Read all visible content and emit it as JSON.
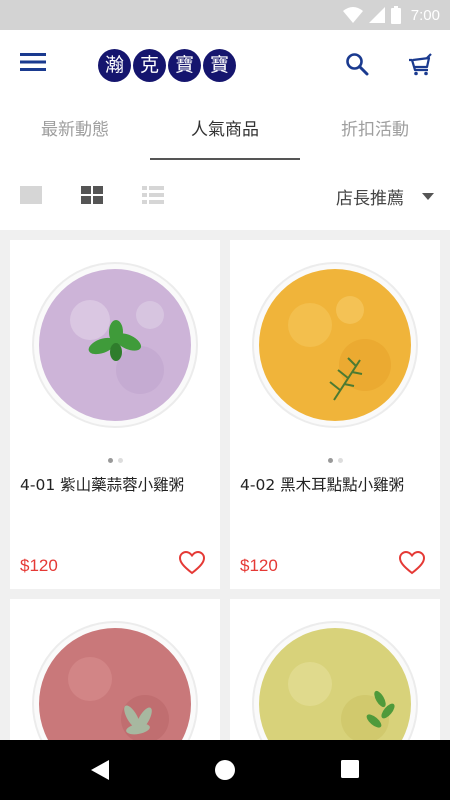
{
  "status_bar": {
    "time": "7:00"
  },
  "app": {
    "logo_chars": [
      "瀚",
      "克",
      "寶",
      "寶"
    ]
  },
  "tabs": [
    {
      "label": "最新動態",
      "active": false
    },
    {
      "label": "人氣商品",
      "active": true
    },
    {
      "label": "折扣活動",
      "active": false
    }
  ],
  "toolbar": {
    "sort_label": "店長推薦"
  },
  "products": [
    {
      "title": "4-01 紫山藥蒜蓉小雞粥",
      "price": "$120",
      "porridge_color": "#cdb4d8",
      "garnish": "mint"
    },
    {
      "title": "4-02 黑木耳點點小雞粥",
      "price": "$120",
      "porridge_color": "#f0b43a",
      "garnish": "rosemary"
    },
    {
      "title": "",
      "price": "",
      "porridge_color": "#c9787a",
      "garnish": "sage"
    },
    {
      "title": "",
      "price": "",
      "porridge_color": "#d8d27a",
      "garnish": "herb"
    }
  ],
  "colors": {
    "accent_price": "#e53935",
    "logo_bg": "#15156e",
    "icon_blue": "#1a3a8f"
  }
}
